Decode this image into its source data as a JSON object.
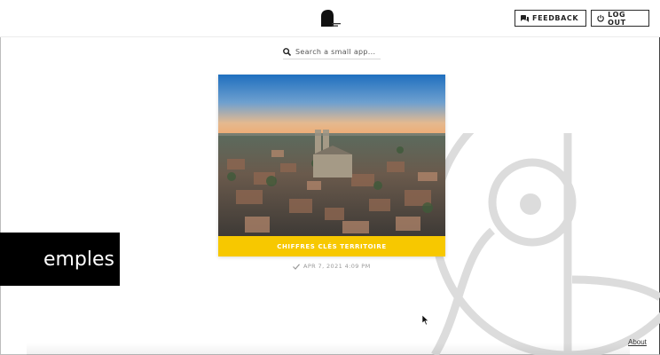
{
  "header": {
    "feedback_label": "FEEDBACK",
    "logout_label": "LOG OUT"
  },
  "search": {
    "placeholder": "Search a small app..."
  },
  "apps": [
    {
      "title": "CHIFFRES CLÉS TERRITOIRE",
      "date": "APR 7, 2021 4:09 PM"
    }
  ],
  "tooltip": {
    "text": "emples"
  },
  "footer": {
    "about_label": "About"
  },
  "colors": {
    "accent": "#f7c800",
    "border": "#2b2b2b"
  }
}
